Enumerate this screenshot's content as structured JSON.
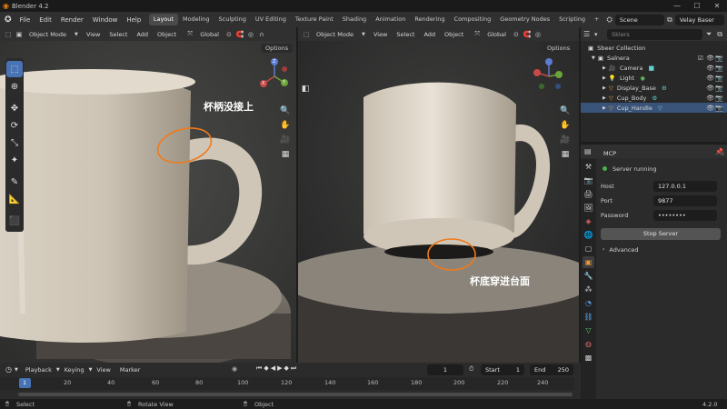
{
  "app": {
    "title": "Blender 4.2",
    "version": "4.2.0"
  },
  "menu": {
    "items": [
      "File",
      "Edit",
      "Render",
      "Window",
      "Help"
    ]
  },
  "workspaces": [
    "Layout",
    "Modeling",
    "Sculpting",
    "UV Editing",
    "Texture Paint",
    "Shading",
    "Animation",
    "Rendering",
    "Compositing",
    "Geometry Nodes",
    "Scripting"
  ],
  "workspace_add": "+",
  "scene": {
    "label": "Scene"
  },
  "view_layer": {
    "label": "Velay Baser"
  },
  "viewport_header": {
    "mode": "Object Mode",
    "menus": [
      "View",
      "Select",
      "Add",
      "Object"
    ],
    "transform_orientation": "Global",
    "options": "Options"
  },
  "viewport_left": {
    "annotation": "杯柄没接上"
  },
  "viewport_right": {
    "annotation": "杯底穿进台面"
  },
  "gizmo": {
    "x": "X",
    "y": "Y",
    "z": "Z"
  },
  "outliner": {
    "search_placeholder": "Sklers",
    "root": "Sbeer Collection",
    "collection": "Salnera",
    "items": [
      "Camera",
      "Light",
      "Display_Base",
      "Cup_Body",
      "Cup_Handle"
    ]
  },
  "mcp": {
    "header": "MCP",
    "status": "Server running",
    "host_label": "Host",
    "host_value": "127.0.0.1",
    "port_label": "Port",
    "port_value": "9877",
    "password_label": "Password",
    "password_value": "••••••••",
    "stop_button": "Stop Server",
    "advanced": "Advanced",
    "status_color": "#4caf50"
  },
  "timeline": {
    "menus": [
      "Playback",
      "Keying",
      "View",
      "Marker"
    ],
    "current_frame": "1",
    "start_label": "Start",
    "start_value": "1",
    "end_label": "End",
    "end_value": "250",
    "ticks": [
      "1",
      "20",
      "40",
      "60",
      "80",
      "100",
      "120",
      "140",
      "160",
      "180",
      "200",
      "220",
      "240"
    ]
  },
  "status": {
    "select": "Select",
    "rotate": "Rotate View",
    "object": "Object"
  },
  "colors": {
    "accent": "#4772b3",
    "annotation_circle": "#f07a1a"
  }
}
